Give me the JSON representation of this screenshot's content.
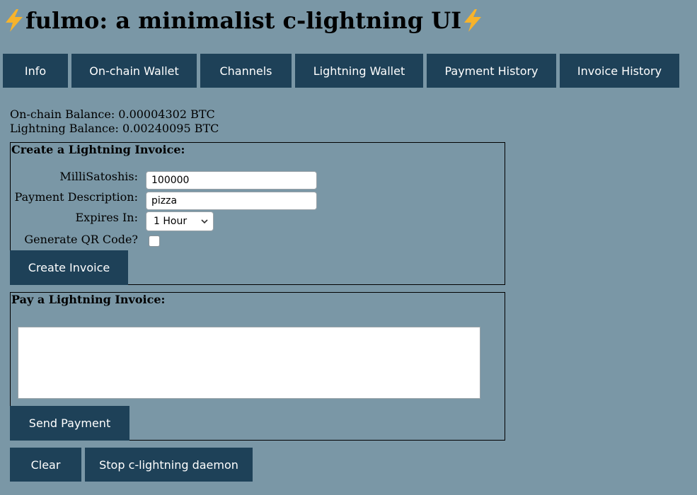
{
  "header": {
    "title": "fulmo: a minimalist c-lightning UI",
    "emoji_icon": "lightning-bolt-emoji"
  },
  "nav": {
    "items": [
      {
        "label": "Info"
      },
      {
        "label": "On-chain Wallet"
      },
      {
        "label": "Channels"
      },
      {
        "label": "Lightning Wallet"
      },
      {
        "label": "Payment History"
      },
      {
        "label": "Invoice History"
      }
    ]
  },
  "balances": {
    "onchain": "On-chain Balance: 0.00004302 BTC",
    "lightning": "Lightning Balance: 0.00240095 BTC"
  },
  "create_invoice": {
    "title": "Create a Lightning Invoice:",
    "msat_label": "MilliSatoshis:",
    "msat_value": "100000",
    "desc_label": "Payment Description:",
    "desc_value": "pizza",
    "expires_label": "Expires In:",
    "expires_value": "1 Hour",
    "qr_label": "Generate QR Code?",
    "qr_checked": false,
    "submit_label": "Create Invoice"
  },
  "pay_invoice": {
    "title": "Pay a Lightning Invoice:",
    "invoice_value": "",
    "submit_label": "Send Payment"
  },
  "footer": {
    "clear_label": "Clear",
    "stop_label": "Stop c-lightning daemon"
  },
  "colors": {
    "background": "#7a97a6",
    "button": "#1e4158",
    "button_text": "#ffffff",
    "bolt": "#f7b32b"
  }
}
